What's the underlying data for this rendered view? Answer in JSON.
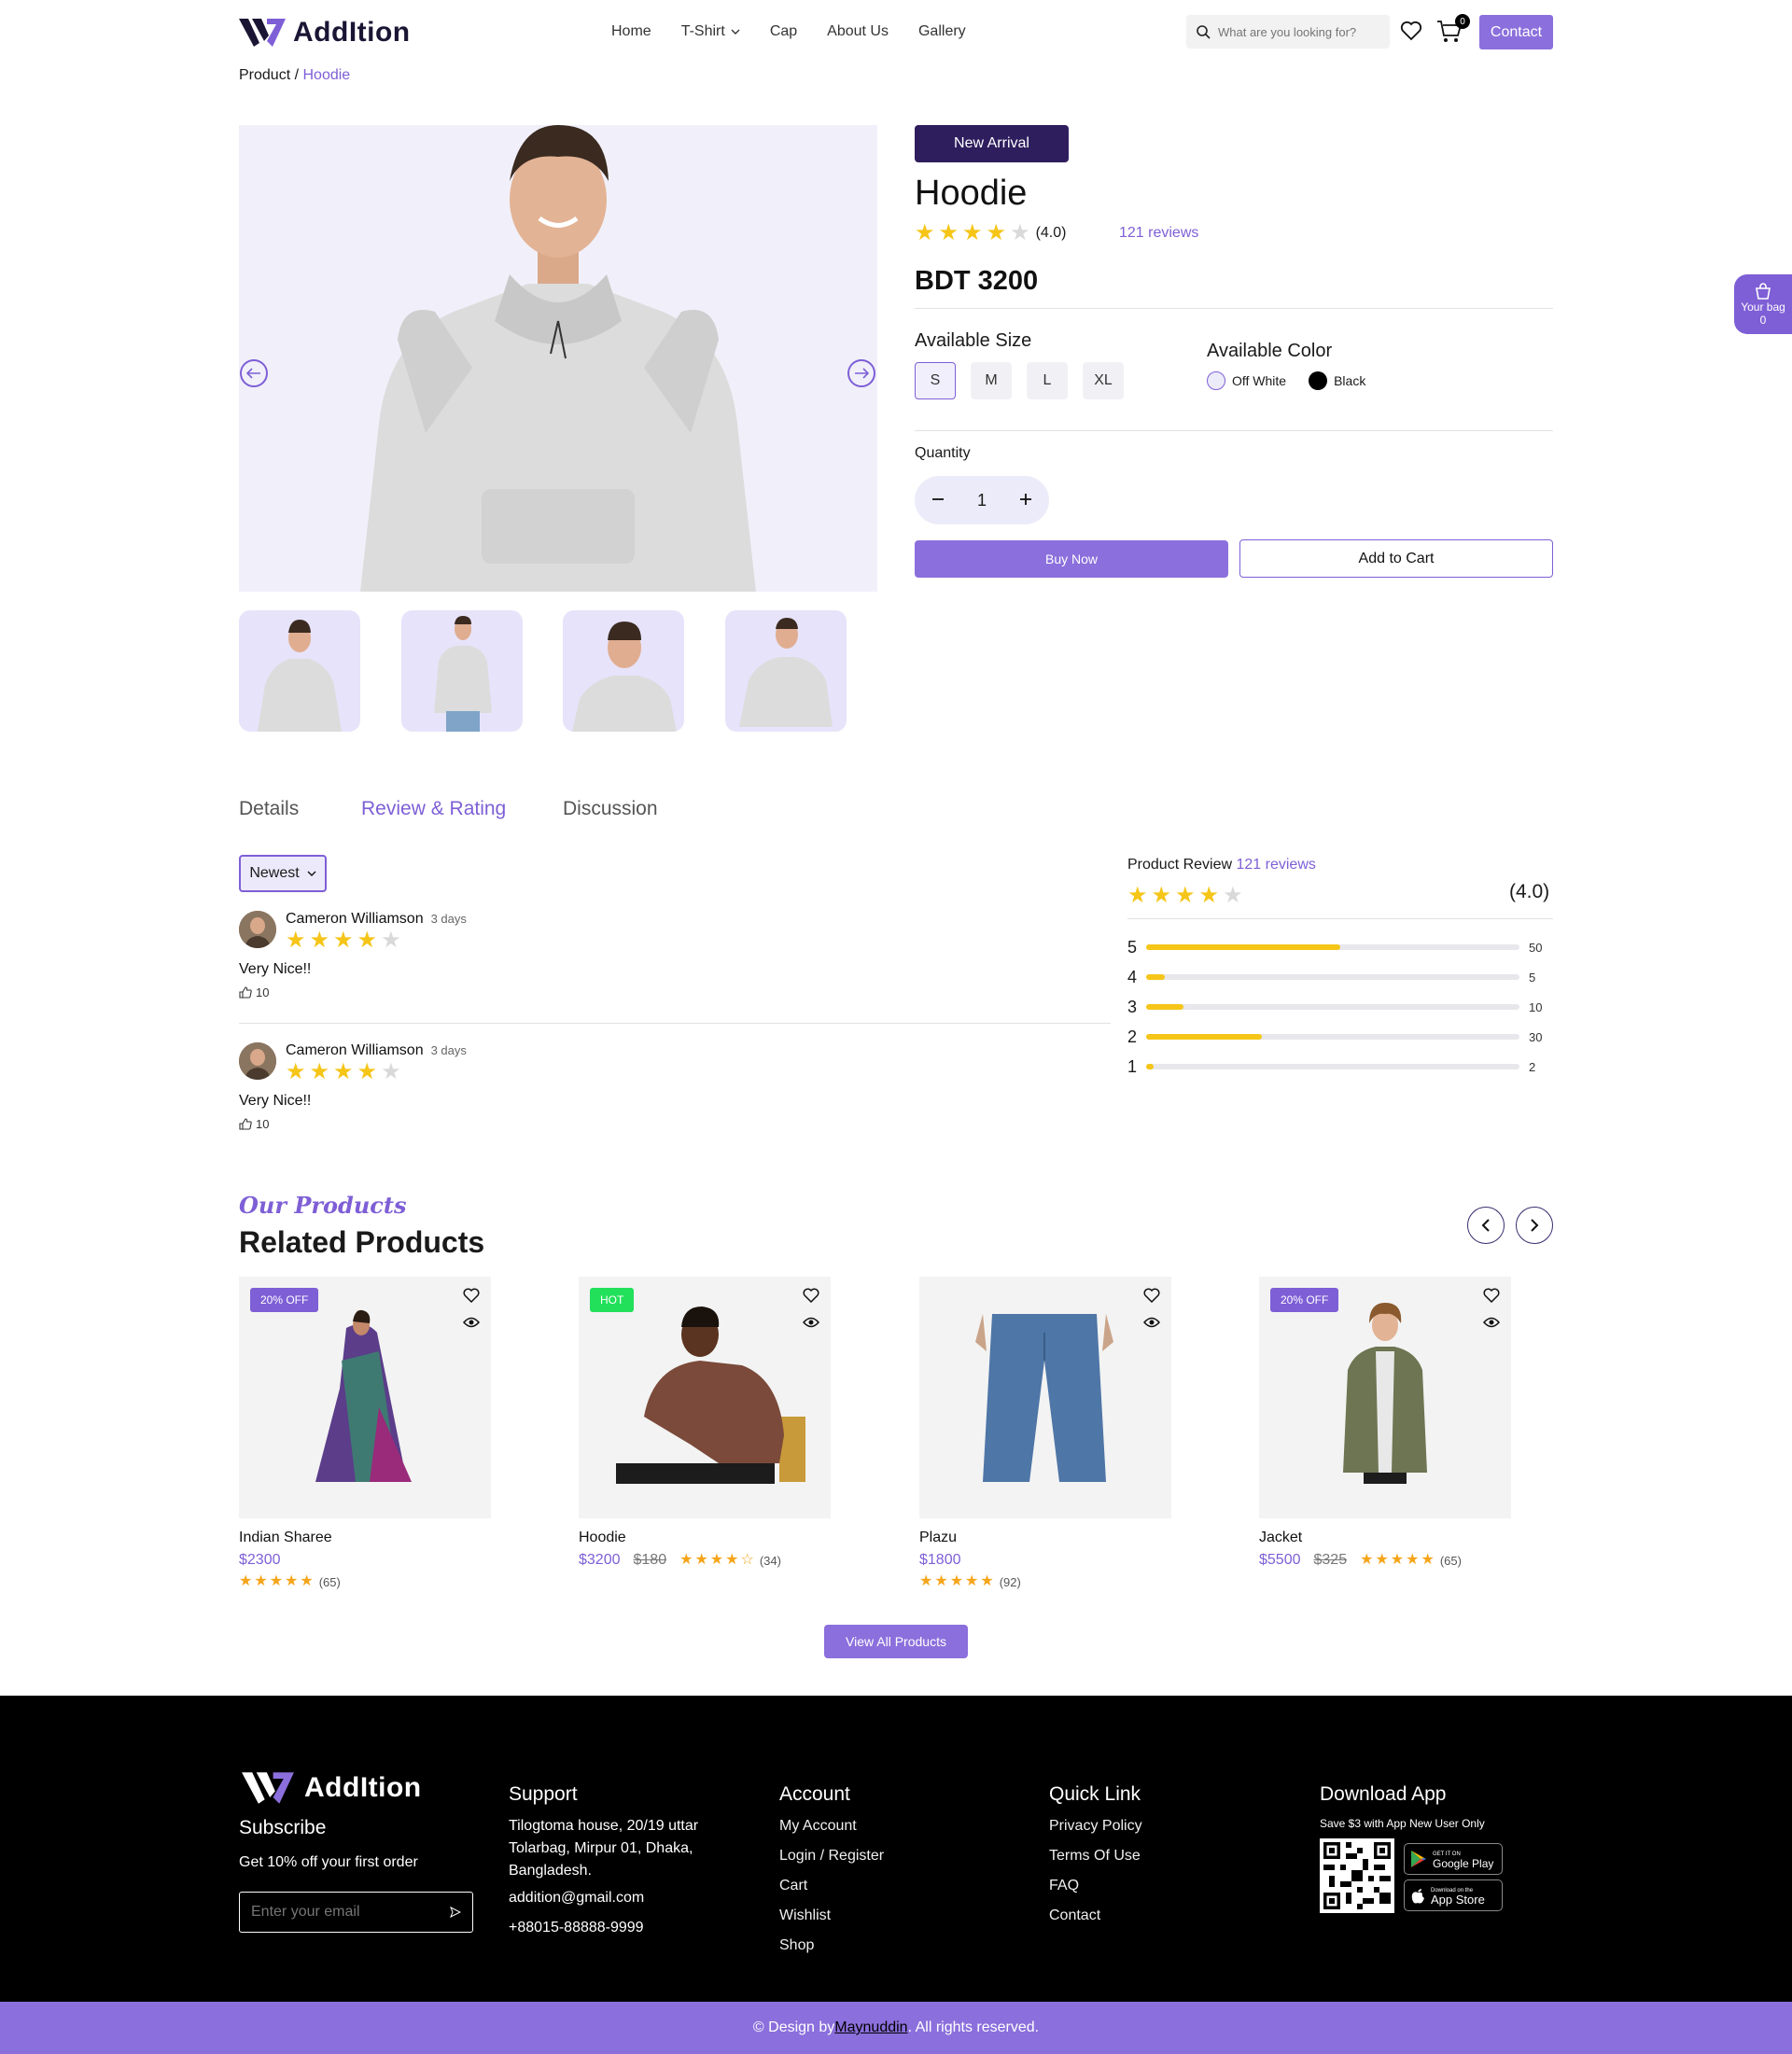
{
  "header": {
    "brand": "AddItion",
    "nav": [
      "Home",
      "T-Shirt",
      "Cap",
      "About Us",
      "Gallery"
    ],
    "search_placeholder": "What are you looking for?",
    "cart_count": "0",
    "contact_label": "Contact"
  },
  "breadcrumb": {
    "root": "Product",
    "separator": " / ",
    "current": "Hoodie"
  },
  "product": {
    "badge": "New Arrival",
    "name": "Hoodie",
    "rating": 4,
    "rating_text": "(4.0)",
    "reviews_link": "121 reviews",
    "price": "BDT 3200",
    "size_label": "Available Size",
    "sizes": [
      "S",
      "M",
      "L",
      "XL"
    ],
    "selected_size": "S",
    "color_label": "Available Color",
    "colors": [
      {
        "name": "Off White",
        "swatch": "#ecebf9"
      },
      {
        "name": "Black",
        "swatch": "#000000"
      }
    ],
    "quantity_label": "Quantity",
    "quantity": "1",
    "buy_label": "Buy Now",
    "cart_label": "Add to Cart"
  },
  "bag": {
    "label": "Your bag",
    "count": "0"
  },
  "tabs": {
    "items": [
      "Details",
      "Review & Rating",
      "Discussion"
    ],
    "active": "Review & Rating"
  },
  "reviews": {
    "sort_value": "Newest",
    "items": [
      {
        "name": "Cameron Williamson",
        "time": "3 days",
        "rating": 4,
        "text": "Very Nice!!",
        "likes": "10"
      },
      {
        "name": "Cameron Williamson",
        "time": "3 days",
        "rating": 4,
        "text": "Very Nice!!",
        "likes": "10"
      }
    ],
    "summary": {
      "title": "Product Review",
      "reviews_link": "121 reviews",
      "rating": 4,
      "rating_text": "(4.0)",
      "breakdown": [
        {
          "star": "5",
          "count": "50",
          "fraction": 0.52
        },
        {
          "star": "4",
          "count": "5",
          "fraction": 0.05
        },
        {
          "star": "3",
          "count": "10",
          "fraction": 0.1
        },
        {
          "star": "2",
          "count": "30",
          "fraction": 0.31
        },
        {
          "star": "1",
          "count": "2",
          "fraction": 0.02
        }
      ]
    }
  },
  "related": {
    "kicker": "Our Products",
    "title": "Related Products",
    "products": [
      {
        "tag": "20% OFF",
        "tag_color": "#7e5fd6",
        "name": "Indian Sharee",
        "price": "$2300",
        "old_price": "",
        "rating": 5,
        "count": "(65)"
      },
      {
        "tag": "HOT",
        "tag_color": "#22e05a",
        "name": "Hoodie",
        "price": "$3200",
        "old_price": "$180",
        "rating": 4,
        "count": "(34)"
      },
      {
        "tag": "",
        "tag_color": "",
        "name": "Plazu",
        "price": "$1800",
        "old_price": "",
        "rating": 5,
        "count": "(92)"
      },
      {
        "tag": "20% OFF",
        "tag_color": "#7e5fd6",
        "name": "Jacket",
        "price": "$5500",
        "old_price": "$325",
        "rating": 5,
        "count": "(65)"
      }
    ],
    "view_all": "View All Products"
  },
  "footer": {
    "brand": "AddItion",
    "subscribe_title": "Subscribe",
    "subscribe_text": "Get 10% off your first order",
    "email_placeholder": "Enter your email",
    "support": {
      "title": "Support",
      "address": "Tilogtoma house, 20/19 uttar Tolarbag, Mirpur 01, Dhaka, Bangladesh.",
      "email": "addition@gmail.com",
      "phone": "+88015-88888-9999"
    },
    "account": {
      "title": "Account",
      "links": [
        "My Account",
        "Login / Register",
        "Cart",
        "Wishlist",
        "Shop"
      ]
    },
    "quick": {
      "title": "Quick Link",
      "links": [
        "Privacy Policy",
        "Terms Of Use",
        "FAQ",
        "Contact"
      ]
    },
    "app": {
      "title": "Download App",
      "promo": "Save $3 with App New User Only",
      "google_small": "GET IT ON",
      "google": "Google Play",
      "apple_small": "Download on the",
      "apple": "App Store"
    },
    "copyright_prefix": "© Design by ",
    "copyright_author": "Maynuddin",
    "copyright_suffix": ". All rights reserved."
  },
  "colors": {
    "accent": "#8b6fdc",
    "dark": "#2f1e5e",
    "star": "#f5c518"
  }
}
